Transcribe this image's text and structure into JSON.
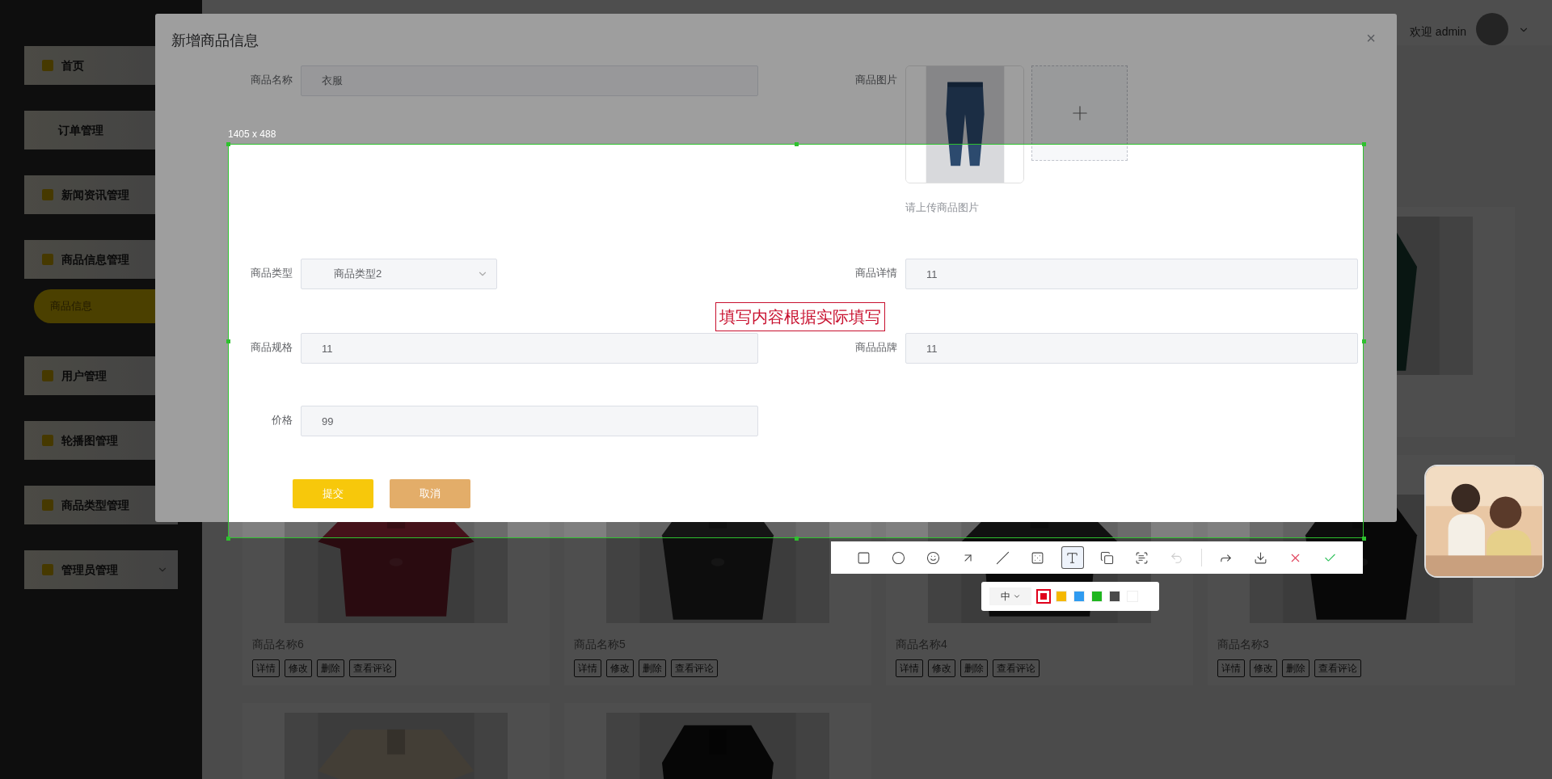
{
  "sidebar": {
    "items": [
      {
        "label": "首页",
        "has_icon": true,
        "kind": "link"
      },
      {
        "label": "订单管理",
        "has_icon": false,
        "kind": "link"
      },
      {
        "label": "新闻资讯管理",
        "has_icon": true,
        "kind": "link"
      },
      {
        "label": "商品信息管理",
        "has_icon": true,
        "kind": "link",
        "children": [
          {
            "label": "商品信息",
            "selected": true
          }
        ]
      },
      {
        "label": "用户管理",
        "has_icon": true,
        "kind": "link"
      },
      {
        "label": "轮播图管理",
        "has_icon": true,
        "kind": "link"
      },
      {
        "label": "商品类型管理",
        "has_icon": true,
        "kind": "link"
      },
      {
        "label": "管理员管理",
        "has_icon": true,
        "kind": "submenu"
      }
    ]
  },
  "header": {
    "greeting": "欢迎 admin"
  },
  "products": [
    {
      "kind": "picture"
    },
    {
      "kind": "card",
      "name": "商品名称6",
      "actions": [
        "详情",
        "修改",
        "删除",
        "查看评论"
      ]
    },
    {
      "kind": "card",
      "name": "商品名称5",
      "actions": [
        "详情",
        "修改",
        "删除",
        "查看评论"
      ]
    },
    {
      "kind": "card",
      "name": "商品名称4",
      "actions": [
        "详情",
        "修改",
        "删除",
        "查看评论"
      ]
    },
    {
      "kind": "card",
      "name": "商品名称3",
      "actions": [
        "详情",
        "修改",
        "删除",
        "查看评论"
      ]
    },
    {
      "kind": "picture"
    },
    {
      "kind": "picture"
    }
  ],
  "modal": {
    "title": "新增商品信息",
    "close": "×",
    "fields": [
      {
        "label": "商品名称",
        "kind": "input",
        "value": "衣服"
      },
      {
        "label": "商品图片",
        "kind": "upload",
        "hint": "请上传商品图片"
      },
      {
        "label": "商品类型",
        "kind": "select",
        "value": "商品类型2"
      },
      {
        "label": "商品详情",
        "kind": "input",
        "value": "11"
      },
      {
        "label": "商品规格",
        "kind": "input",
        "value": "11"
      },
      {
        "label": "商品品牌",
        "kind": "input",
        "value": "11"
      },
      {
        "label": "价格",
        "kind": "input",
        "value": "99"
      }
    ],
    "buttons": [
      {
        "label": "提交",
        "kind": "primary"
      },
      {
        "label": "取消",
        "kind": "cancel"
      }
    ]
  },
  "capture": {
    "size_label": "1405 x 488",
    "annotation": "填写内容根据实际填写",
    "tools": [
      {
        "kind": "rect",
        "selected": false
      },
      {
        "kind": "ellipse",
        "selected": false
      },
      {
        "kind": "emoji",
        "selected": false
      },
      {
        "kind": "arrow",
        "selected": false
      },
      {
        "kind": "line",
        "selected": false
      },
      {
        "kind": "mosaic",
        "selected": false
      },
      {
        "kind": "text",
        "selected": true
      },
      {
        "kind": "copy",
        "selected": false
      },
      {
        "kind": "ocr",
        "selected": false
      },
      {
        "kind": "undo",
        "selected": false,
        "disabled": true
      },
      {
        "kind": "share",
        "selected": false
      },
      {
        "kind": "save",
        "selected": false
      },
      {
        "kind": "cancel"
      },
      {
        "kind": "done"
      }
    ],
    "font_size": "中",
    "colors": [
      {
        "color": "#e0001b",
        "selected": true
      },
      {
        "color": "#f5b800",
        "selected": false
      },
      {
        "color": "#2f9bf0",
        "selected": false
      },
      {
        "color": "#1fb61f",
        "selected": false
      },
      {
        "color": "#4a4a4a",
        "selected": false
      },
      {
        "color": "#ffffff",
        "selected": false
      }
    ]
  }
}
